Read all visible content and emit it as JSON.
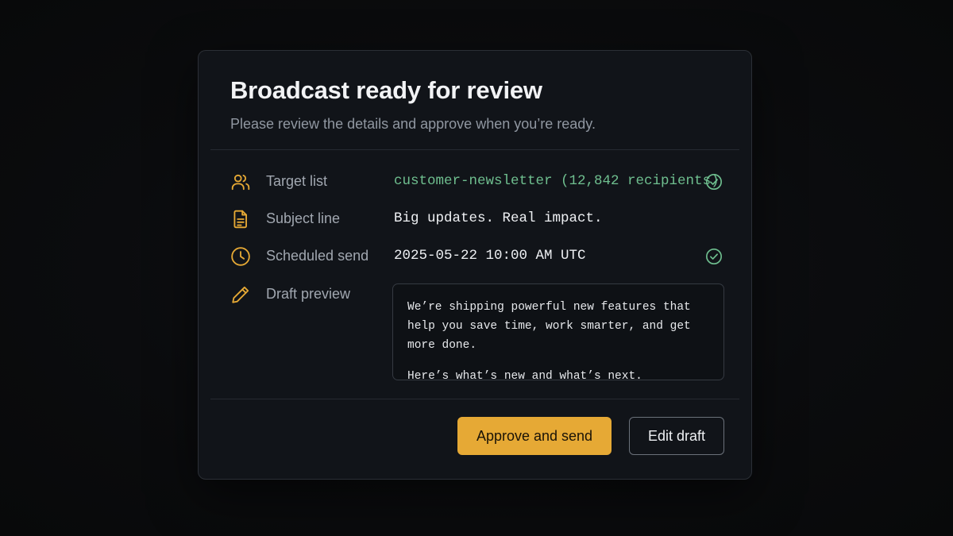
{
  "dialog": {
    "title": "Broadcast ready for review",
    "subtitle": "Please review the details and approve when you’re ready."
  },
  "details": {
    "target_list": {
      "icon": "users-icon",
      "label": "Target list",
      "value": "customer-newsletter (12,842 recipients)",
      "verified": true
    },
    "subject_line": {
      "icon": "document-icon",
      "label": "Subject line",
      "value": "Big updates. Real impact."
    },
    "scheduled_send": {
      "icon": "clock-icon",
      "label": "Scheduled send",
      "value": "2025-05-22 10:00 AM UTC",
      "verified": true
    },
    "draft_preview": {
      "icon": "pencil-icon",
      "label": "Draft preview",
      "paragraph_1": "We’re shipping powerful new features that help you save time, work smarter, and get more done.",
      "paragraph_2": "Here’s what’s new and what’s next."
    }
  },
  "actions": {
    "approve_label": "Approve and send",
    "edit_label": "Edit draft"
  },
  "colors": {
    "accent": "#e6a935",
    "success": "#6fbf8f",
    "background": "#0a0b0d",
    "surface": "#111419"
  }
}
